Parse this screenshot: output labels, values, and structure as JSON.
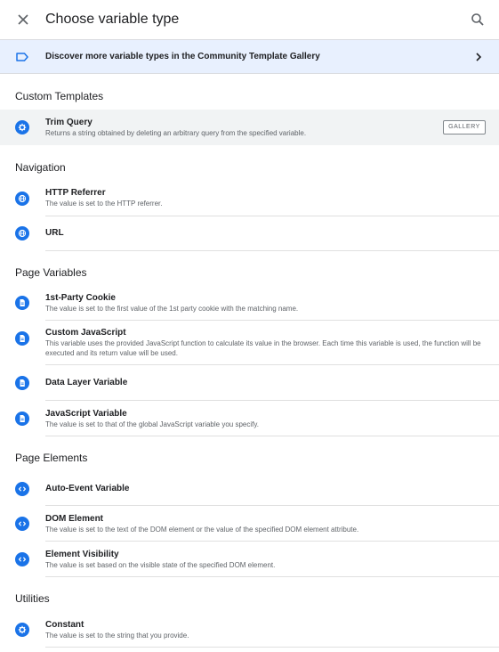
{
  "header": {
    "title": "Choose variable type",
    "close_icon": "close-icon",
    "search_icon": "search-icon"
  },
  "banner": {
    "text": "Discover more variable types in the Community Template Gallery",
    "icon": "label-outline-icon",
    "chevron": "chevron-right-icon"
  },
  "sections": {
    "custom_templates": {
      "heading": "Custom Templates",
      "items": [
        {
          "title": "Trim Query",
          "description": "Returns a string obtained by deleting an arbitrary query from the specified variable.",
          "icon": "gear-icon",
          "badge": "GALLERY"
        }
      ]
    },
    "navigation": {
      "heading": "Navigation",
      "items": [
        {
          "title": "HTTP Referrer",
          "description": "The value is set to the HTTP referrer.",
          "icon": "globe-icon"
        },
        {
          "title": "URL",
          "description": "",
          "icon": "globe-icon"
        }
      ]
    },
    "page_variables": {
      "heading": "Page Variables",
      "items": [
        {
          "title": "1st-Party Cookie",
          "description": "The value is set to the first value of the 1st party cookie with the matching name.",
          "icon": "document-icon"
        },
        {
          "title": "Custom JavaScript",
          "description": "This variable uses the provided JavaScript function to calculate its value in the browser. Each time this variable is used, the function will be executed and its return value will be used.",
          "icon": "document-icon"
        },
        {
          "title": "Data Layer Variable",
          "description": "",
          "icon": "document-icon"
        },
        {
          "title": "JavaScript Variable",
          "description": "The value is set to that of the global JavaScript variable you specify.",
          "icon": "document-icon"
        }
      ]
    },
    "page_elements": {
      "heading": "Page Elements",
      "items": [
        {
          "title": "Auto-Event Variable",
          "description": "",
          "icon": "code-icon"
        },
        {
          "title": "DOM Element",
          "description": "The value is set to the text of the DOM element or the value of the specified DOM element attribute.",
          "icon": "code-icon"
        },
        {
          "title": "Element Visibility",
          "description": "The value is set based on the visible state of the specified DOM element.",
          "icon": "code-icon"
        }
      ]
    },
    "utilities": {
      "heading": "Utilities",
      "items": [
        {
          "title": "Constant",
          "description": "The value is set to the string that you provide.",
          "icon": "gear-icon"
        }
      ]
    }
  },
  "colors": {
    "accent": "#1a73e8",
    "banner_background": "#e8f0fe",
    "selected_row": "#f1f3f4",
    "divider": "#e0e0e0"
  }
}
